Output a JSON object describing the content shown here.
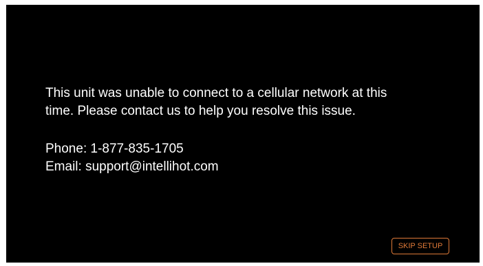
{
  "message": {
    "line1": "This unit was unable to connect to a cellular network at this",
    "line2": "time. Please contact us to help you resolve this issue."
  },
  "contact": {
    "phone": "Phone: 1-877-835-1705",
    "email": "Email: support@intellihot.com"
  },
  "actions": {
    "skip_label": "SKIP SETUP"
  },
  "colors": {
    "background": "#000000",
    "text": "#ffffff",
    "accent": "#e07a38"
  }
}
